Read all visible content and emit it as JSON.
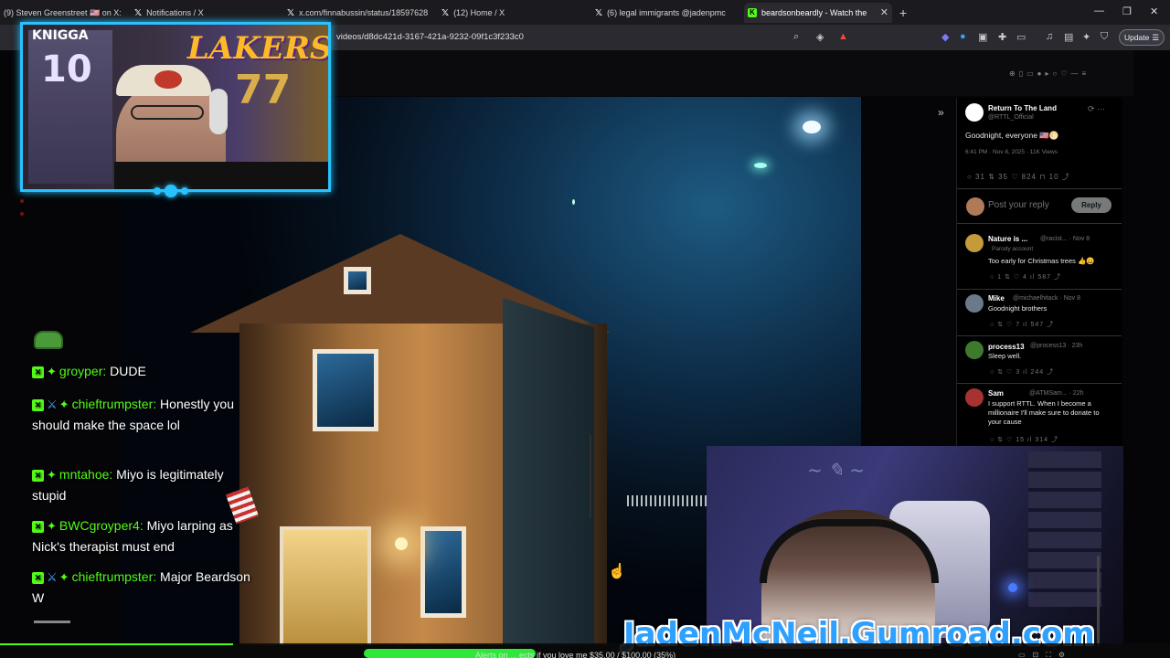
{
  "browser": {
    "tabs": [
      {
        "label": "(9) Steven Greenstreet 🇺🇸 on X:",
        "icon": "x-logo-icon"
      },
      {
        "label": "Notifications / X",
        "icon": "x-logo-icon"
      },
      {
        "label": "x.com/finnabussin/status/18597628",
        "icon": "x-logo-icon"
      },
      {
        "label": "(12) Home / X",
        "icon": "x-logo-icon"
      },
      {
        "label": "(6) legal immigrants @jadenpmc",
        "icon": "x-logo-icon"
      },
      {
        "label": "beardsonbeardly - Watch the",
        "icon": "kick-logo-icon",
        "active": true
      }
    ],
    "new_tab": "+",
    "url": "videos/d8dc421d-3167-421a-9232-09f1c3f233c0",
    "update_label": "Update"
  },
  "webcam": {
    "jersey_name": "KNIGGA",
    "jersey_number": "10",
    "lakers": "LAKERS",
    "lakers_number": "77"
  },
  "chat": {
    "messages": [
      {
        "user": "groyper:",
        "text": "DUDE",
        "badges": [
          "kick",
          "diamond"
        ]
      },
      {
        "user": "chieftrumpster:",
        "text": "Honestly you should make the space lol",
        "badges": [
          "kick",
          "sword",
          "diamond"
        ]
      },
      {
        "user": "mntahoe:",
        "text": "Miyo is legitimately stupid",
        "badges": [
          "kick",
          "diamond"
        ]
      },
      {
        "user": "BWCgroyper4:",
        "text": "Miyo larping as Nick's therapist must end",
        "badges": [
          "kick",
          "diamond"
        ]
      },
      {
        "user": "chieftrumpster:",
        "text": "Major Beardson W",
        "badges": [
          "kick",
          "sword",
          "diamond"
        ]
      }
    ]
  },
  "x_panel": {
    "post": {
      "name": "Return To The Land",
      "handle": "@RTTL_Official",
      "text": "Goodnight, everyone 🇺🇸🌕",
      "meta": "6:41 PM · Nov 8, 2025 · 11K Views",
      "actions": "○ 31   ⇅ 35   ♡ 824   ⊓ 10   ⤴"
    },
    "reply_placeholder": "Post your reply",
    "reply_button": "Reply",
    "replies": [
      {
        "name": "Nature is ...",
        "handle": "@racist... · Nov 8",
        "sub": "Parody account",
        "text": "Too early for Christmas trees 👍😄",
        "actions": "○ 1   ⇅   ♡ 4   ıl 587   ⤴"
      },
      {
        "name": "Mike",
        "handle": "@michaelhitack · Nov 8",
        "text": "Goodnight brothers",
        "actions": "○   ⇅   ♡ 7   ıl 547   ⤴"
      },
      {
        "name": "process13",
        "handle": "@process13 · 23h",
        "text": "Sleep well.",
        "actions": "○   ⇅   ♡ 3   ıl 244   ⤴"
      },
      {
        "name": "Sam",
        "handle": "@ATMSam... · 22h",
        "text": "I support RTTL. When I become a millionaire I'll make sure to donate to your cause",
        "actions": "○   ⇅   ♡ 15   ıl 314   ⤴"
      }
    ]
  },
  "overlay": {
    "gumroad": "JadenMcNeil.Gumroad.com",
    "ticker": "Alerts on ... ects if you love me $35.00 / $100.00 (35%)"
  }
}
